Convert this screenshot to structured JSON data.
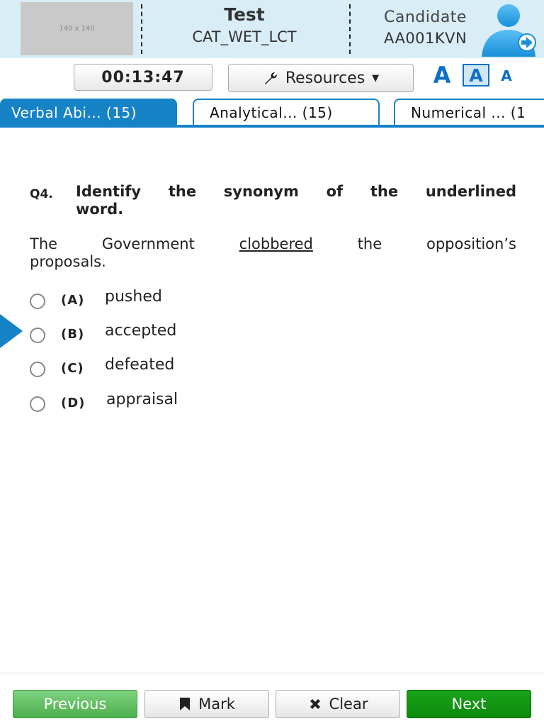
{
  "header": {
    "logo_placeholder": "140 x 140",
    "test_label": "Test",
    "test_code": "CAT_WET_LCT",
    "candidate_label": "Candidate",
    "candidate_id": "AA001KVN",
    "accent_color": "#1683c7"
  },
  "toolbar": {
    "timer": "00:13:47",
    "resources_label": "Resources",
    "font_sizes": [
      "A",
      "A",
      "A"
    ]
  },
  "tabs": [
    {
      "label": "Verbal Abi... (15)",
      "active": true
    },
    {
      "label": "Analytical... (15)",
      "active": false
    },
    {
      "label": "Numerical ... (1",
      "active": false
    }
  ],
  "question": {
    "number": "Q4.",
    "prompt_line1": [
      "Identify",
      "the",
      "synonym",
      "of",
      "the",
      "underlined"
    ],
    "prompt_line2": "word.",
    "passage_line1": [
      "The",
      "Government",
      "clobbered",
      "the",
      "opposition’s"
    ],
    "passage_line2": "proposals.",
    "underlined_word": "clobbered",
    "options": [
      {
        "letter": "(A)",
        "text": "pushed"
      },
      {
        "letter": "(B)",
        "text": "accepted"
      },
      {
        "letter": "(C)",
        "text": "defeated"
      },
      {
        "letter": "(D)",
        "text": "appraisal"
      }
    ],
    "current_pointer_option": "(B)"
  },
  "footer": {
    "previous_label": "Previous",
    "mark_label": "Mark",
    "clear_label": "Clear",
    "next_label": "Next"
  }
}
